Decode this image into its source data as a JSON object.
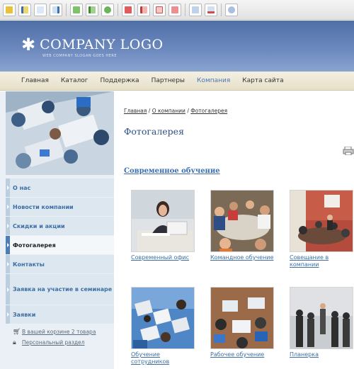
{
  "header": {
    "logo_text": "COMPANY LOGO",
    "logo_slogan": "WEB COMPANY SLOGAN GOES HERE"
  },
  "topnav": {
    "items": [
      "Главная",
      "Каталог",
      "Поддержка",
      "Партнеры",
      "Компания",
      "Карта сайта"
    ],
    "active": "Компания"
  },
  "sidebar": {
    "menu": [
      {
        "label": "О нас"
      },
      {
        "label": "Новости компании"
      },
      {
        "label": "Скидки и акции"
      },
      {
        "label": "Фотогалерея"
      },
      {
        "label": "Контакты"
      },
      {
        "label": "Заявка на участие в семинаре"
      },
      {
        "label": "Заявки"
      }
    ],
    "active_menu": "Фотогалерея",
    "links": [
      {
        "icon": "cart-icon",
        "label": "В вашей корзине 2 товара"
      },
      {
        "icon": "lock-icon",
        "label": "Персональный раздел"
      }
    ]
  },
  "breadcrumb": {
    "items": [
      "Главная",
      "О компании",
      "Фотогалерея"
    ],
    "separator": "/"
  },
  "page": {
    "title": "Фотогалерея",
    "section_title": "Современное обучение"
  },
  "gallery": [
    {
      "caption": "Современный офис"
    },
    {
      "caption": "Командное обучение"
    },
    {
      "caption": "Совещание в компании"
    },
    {
      "caption": "Обучение сотрудников"
    },
    {
      "caption": "Рабочее обучение"
    },
    {
      "caption": "Планерка"
    }
  ]
}
